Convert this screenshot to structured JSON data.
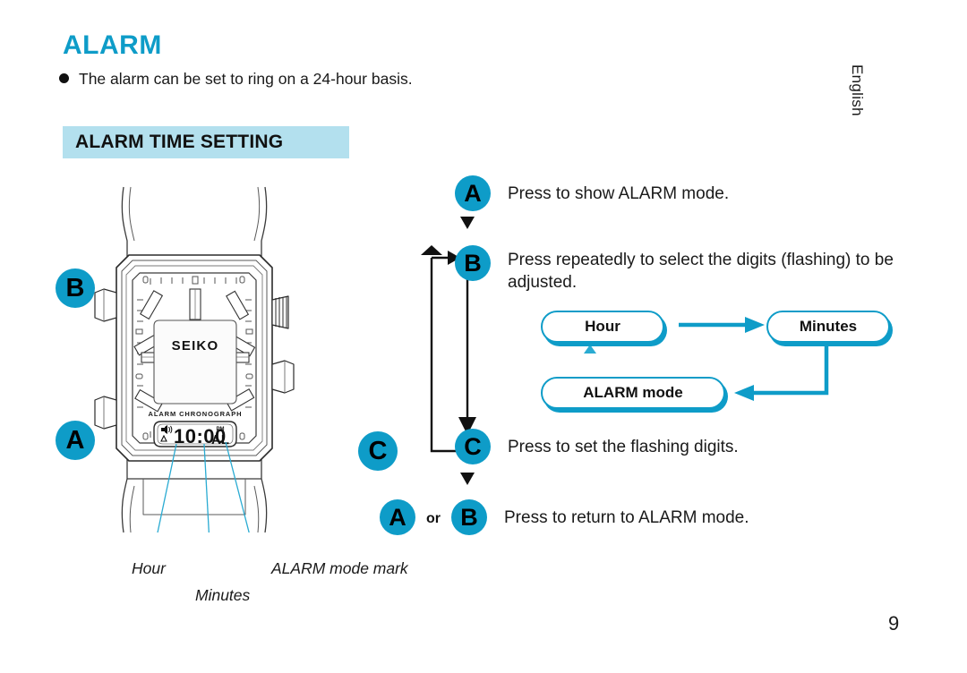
{
  "page": {
    "title": "ALARM",
    "intro": "The alarm can be set to ring on a 24-hour basis.",
    "language": "English",
    "number": "9",
    "accent_color": "#0e9cc8",
    "band_color": "#b3e0ee"
  },
  "section": {
    "heading": "ALARM TIME SETTING"
  },
  "watch": {
    "brand": "SEIKO",
    "lcd_caption": "ALARM CHRONOGRAPH",
    "lcd_time": "10:00",
    "lcd_ampm": "PM",
    "lcd_mode": "AL",
    "button_b": "B",
    "button_a": "A",
    "button_c": "C",
    "callouts": [
      {
        "id": "hour",
        "label": "Hour"
      },
      {
        "id": "minutes",
        "label": "Minutes"
      },
      {
        "id": "alarm-mode-mark",
        "label": "ALARM mode mark"
      }
    ]
  },
  "steps": [
    {
      "id": "a",
      "badge": "A",
      "text": "Press to show ALARM mode."
    },
    {
      "id": "b",
      "badge": "B",
      "text": "Press repeatedly to select the digits (flashing) to be adjusted."
    },
    {
      "id": "c",
      "badge": "C",
      "text": "Press to set the flashing digits."
    },
    {
      "id": "ab",
      "badge": "A",
      "badge2": "B",
      "conjunction": "or",
      "text": "Press to return to ALARM mode."
    }
  ],
  "cycle": {
    "hour": "Hour",
    "minutes": "Minutes",
    "alarm_mode": "ALARM mode"
  }
}
